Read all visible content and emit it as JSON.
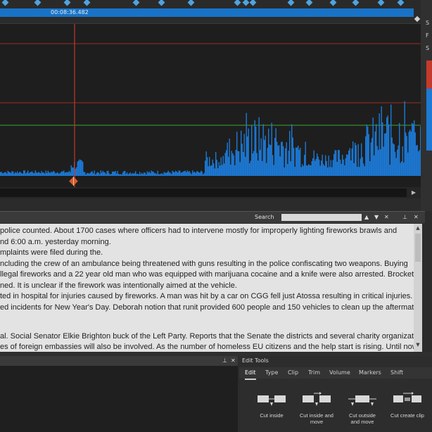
{
  "timeline": {
    "time_readout": "00:08:36.482"
  },
  "right_panel": {
    "letters": [
      "S",
      "F",
      "S"
    ]
  },
  "search_bar": {
    "label": "Search",
    "value": "",
    "buttons": [
      "▲",
      "▼",
      "✕"
    ],
    "close": "✕"
  },
  "transcript": {
    "lines": [
      "police counted. About 1700 cases where officers had to intervene mostly for improperly lighting fireworks brawls and",
      "nd 6:00 a.m. yesterday morning.",
      "mplaints were filed during the.",
      "ncluding the crew of an ambulance being threatened with guns resulting in the police confiscating two weapons. Buying",
      "llegal fireworks and a 22 year old man who was equipped with marijuana cocaine and a knife were also arrested. Brockett",
      "ned. It is unclear if the firework was intentionally aimed at the vehicle.",
      "ted in hospital for injuries caused by fireworks. A man was hit by a car on CGG fell just Atossa resulting in critical injuries.",
      "ed incidents for New Year's Day. Deborah notion that runit provided 600 people and 150 vehicles to clean up the aftermath",
      "",
      "al. Social Senator Elkie Brighton buck of the Left Party. Reports that the Senate the districts and several charity organizations",
      "es of foreign embassies will also be involved. As the number of homeless EU citizens and the help start is rising. Until now"
    ]
  },
  "bottom_left": {
    "pin": "ᵖ",
    "close": "✕"
  },
  "edit_tools": {
    "title": "Edit Tools",
    "tabs": [
      "Edit",
      "Type",
      "Clip",
      "Trim",
      "Volume",
      "Markers",
      "Shift"
    ],
    "active_tab": "Edit",
    "tools": [
      {
        "label": "Cut inside",
        "label2": ""
      },
      {
        "label": "Cut inside and",
        "label2": "move"
      },
      {
        "label": "Cut outside",
        "label2": "and move"
      },
      {
        "label": "Cut create clip",
        "label2": ""
      }
    ]
  },
  "colors": {
    "timeline_blue": "#1873c7",
    "waveform_blue": "#1c7ad6",
    "playhead_red": "#c0392b",
    "level_green": "#3fa534"
  }
}
